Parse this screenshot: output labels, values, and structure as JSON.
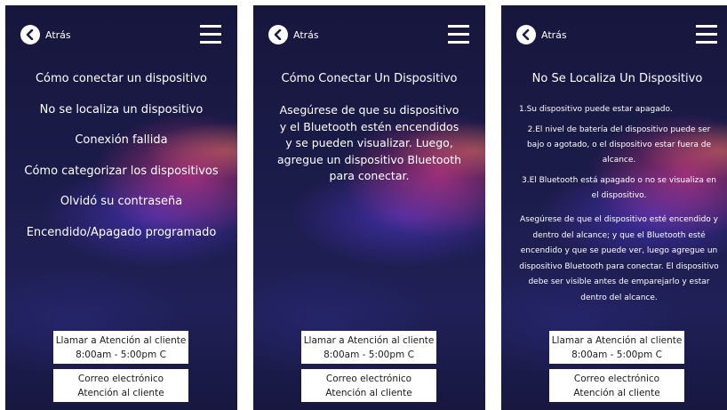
{
  "common": {
    "back_label": "Atrás",
    "call_line1": "Llamar a Atención al cliente",
    "call_line2": "8:00am - 5:00pm C",
    "email_line1": "Correo electrónico",
    "email_line2": "Atención al cliente"
  },
  "screen1": {
    "menu_items": [
      "Cómo conectar un dispositivo",
      "No se localiza un dispositivo",
      "Conexión fallida",
      "Cómo categorizar los dispositivos",
      "Olvidó su contraseña",
      "Encendido/Apagado programado"
    ]
  },
  "screen2": {
    "title": "Cómo Conectar Un Dispositivo",
    "body": "Asegúrese de que su dispositivo y el Bluetooth estén encendidos y se pueden visualizar. Luego, agregue un dispositivo Bluetooth para conectar."
  },
  "screen3": {
    "title": "No Se Localiza Un Dispositivo",
    "reasons": [
      "1.Su dispositivo puede estar apagado.",
      "2.El nivel de batería del dispositivo puede ser bajo o agotado, o el dispositivo estar fuera de alcance.",
      "3.El Bluetooth está apagado o no se visualiza en el dispositivo."
    ],
    "advice": "Asegúrese de que el dispositivo esté encendido y dentro del alcance; y que el Bluetooth esté encendido y que se puede ver, luego agregue un dispositivo Bluetooth para conectar. El dispositivo debe ser visible antes de emparejarlo y estar dentro del alcance."
  }
}
